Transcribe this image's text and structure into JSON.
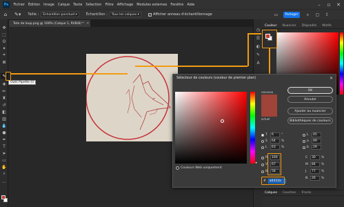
{
  "menubar": {
    "logo": "Ps",
    "items": [
      "Fichier",
      "Édition",
      "Image",
      "Calque",
      "Texte",
      "Sélection",
      "Filtre",
      "Affichage",
      "Modules externes",
      "Fenêtre",
      "Aide"
    ]
  },
  "options": {
    "size_label": "Taille :",
    "size_value": "Échantillon ponctuel",
    "sample_label": "Échantillon :",
    "sample_value": "Tous les calques",
    "show_ring_label": "Afficher anneau d'échantillonnage",
    "share_label": "Partager"
  },
  "document": {
    "tab_title": "Tete de loup.png @ 100% (Calque 1, RVB/8) *"
  },
  "tooltip": {
    "text": "Outil Pipette (I)"
  },
  "panel": {
    "tabs": [
      "Couleur",
      "Nuancier",
      "Dégradés",
      "Motifs"
    ],
    "layer_tabs": [
      "Calques",
      "Couches",
      "Tracés"
    ]
  },
  "dialog": {
    "title": "Sélecteur de couleurs (couleur de premier plan)",
    "new_label": "nouveau",
    "current_label": "actuel",
    "buttons": {
      "ok": "OK",
      "cancel": "Annuler",
      "add_swatch": "Ajouter au nuancier",
      "libraries": "Bibliothèques de couleurs"
    },
    "web_only": "Couleurs Web uniquement",
    "fields": {
      "H": {
        "label": "T",
        "value": "6",
        "unit": "°"
      },
      "S": {
        "label": "S",
        "value": "64",
        "unit": "%"
      },
      "B": {
        "label": "L",
        "value": "63",
        "unit": "%"
      },
      "R": {
        "label": "R",
        "value": "160",
        "unit": ""
      },
      "G": {
        "label": "V",
        "value": "67",
        "unit": ""
      },
      "Bl": {
        "label": "B",
        "value": "58",
        "unit": ""
      },
      "L": {
        "label": "L",
        "value": "45",
        "unit": ""
      },
      "a": {
        "label": "a",
        "value": "49",
        "unit": ""
      },
      "b": {
        "label": "b",
        "value": "29",
        "unit": ""
      },
      "C": {
        "label": "C",
        "value": "30",
        "unit": "%"
      },
      "M": {
        "label": "M",
        "value": "84",
        "unit": "%"
      },
      "J": {
        "label": "J",
        "value": "77",
        "unit": "%"
      },
      "N": {
        "label": "N",
        "value": "26",
        "unit": "%"
      }
    },
    "hex_prefix": "#",
    "hex_value": "a0433a"
  },
  "colors": {
    "accent": "#f39c12",
    "picked": "#a0433a",
    "share": "#1473e6"
  }
}
